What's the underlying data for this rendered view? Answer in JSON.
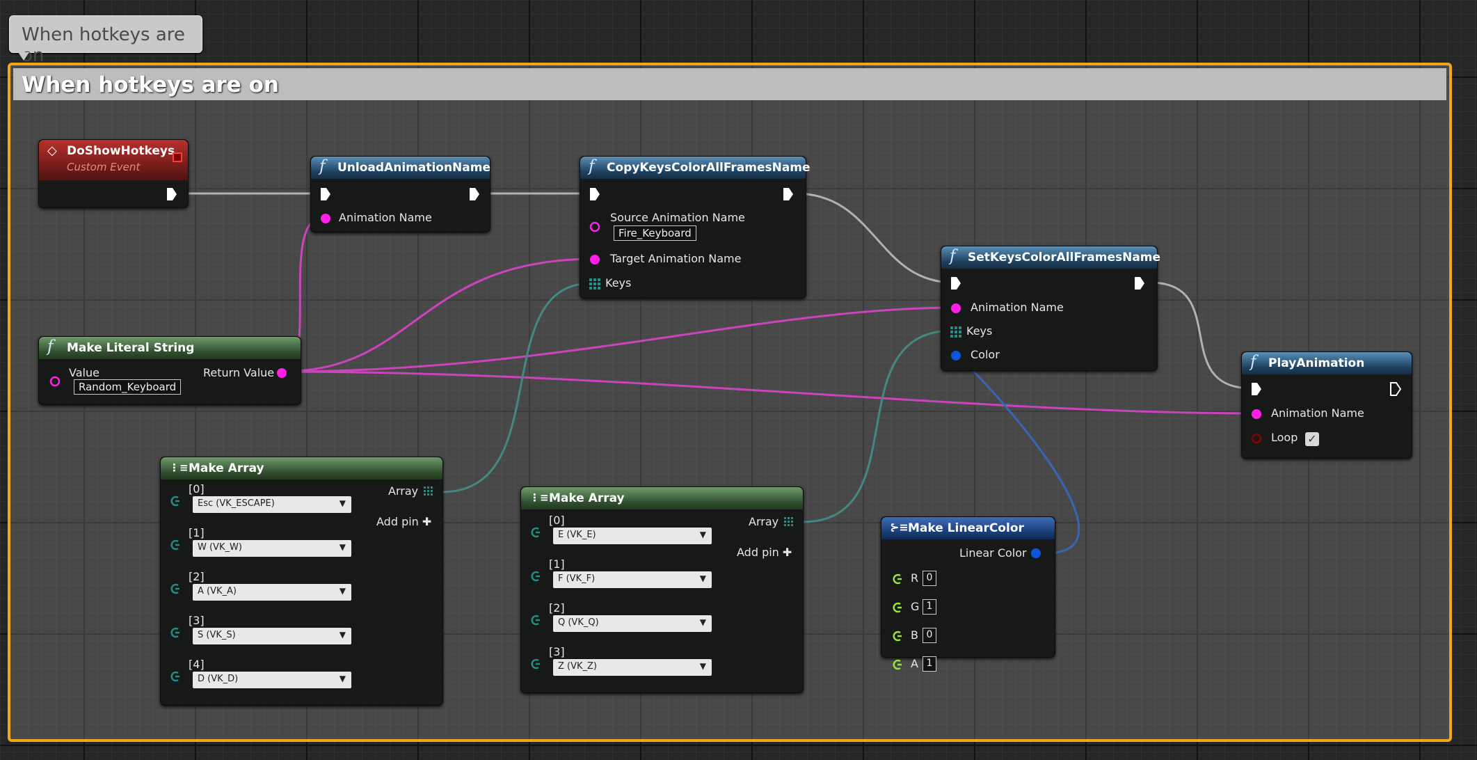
{
  "comment_bubble": {
    "text": "When hotkeys are on"
  },
  "comment_box": {
    "title": "When hotkeys are on"
  },
  "colors": {
    "exec": "#ffffff",
    "string": "#ff1fe8",
    "array": "#1f8f87",
    "struct": "#0c57d9",
    "bool": "#b00000",
    "float": "#9ae53a",
    "comment_border": "#f0a71c"
  },
  "nodes": {
    "do_show_hotkeys": {
      "title": "DoShowHotkeys",
      "subtitle": "Custom Event"
    },
    "unload_animation": {
      "title": "UnloadAnimationName",
      "pin_animation_name": "Animation Name"
    },
    "copy_keys": {
      "title": "CopyKeysColorAllFramesName",
      "pin_source": "Source Animation Name",
      "source_value": "Fire_Keyboard",
      "pin_target": "Target Animation Name",
      "pin_keys": "Keys"
    },
    "set_keys": {
      "title": "SetKeysColorAllFramesName",
      "pin_animation_name": "Animation Name",
      "pin_keys": "Keys",
      "pin_color": "Color"
    },
    "play_animation": {
      "title": "PlayAnimation",
      "pin_animation_name": "Animation Name",
      "pin_loop": "Loop",
      "loop_checked": true
    },
    "make_literal_string": {
      "title": "Make Literal String",
      "pin_value": "Value",
      "value": "Random_Keyboard",
      "pin_return": "Return Value"
    },
    "make_array_1": {
      "title": "Make Array",
      "pin_array": "Array",
      "add_pin": "Add pin",
      "items": [
        {
          "index": "[0]",
          "value": "Esc (VK_ESCAPE)"
        },
        {
          "index": "[1]",
          "value": "W (VK_W)"
        },
        {
          "index": "[2]",
          "value": "A (VK_A)"
        },
        {
          "index": "[3]",
          "value": "S (VK_S)"
        },
        {
          "index": "[4]",
          "value": "D (VK_D)"
        }
      ]
    },
    "make_array_2": {
      "title": "Make Array",
      "pin_array": "Array",
      "add_pin": "Add pin",
      "items": [
        {
          "index": "[0]",
          "value": "E (VK_E)"
        },
        {
          "index": "[1]",
          "value": "F (VK_F)"
        },
        {
          "index": "[2]",
          "value": "Q (VK_Q)"
        },
        {
          "index": "[3]",
          "value": "Z (VK_Z)"
        }
      ]
    },
    "make_linear_color": {
      "title": "Make LinearColor",
      "pin_output": "Linear Color",
      "components": [
        {
          "label": "R",
          "value": "0"
        },
        {
          "label": "G",
          "value": "1"
        },
        {
          "label": "B",
          "value": "0"
        },
        {
          "label": "A",
          "value": "1"
        }
      ]
    }
  }
}
